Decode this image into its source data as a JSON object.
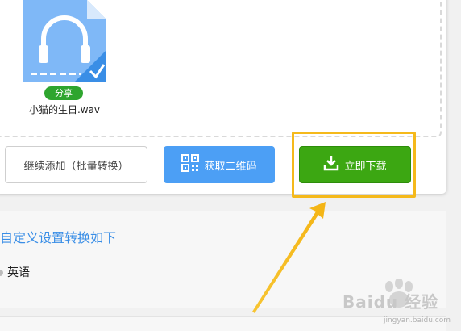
{
  "file": {
    "share_label": "分享",
    "name": "小猫的生日.wav",
    "icon": "headphones-file-icon",
    "check_icon": "checkmark-icon"
  },
  "actions": {
    "continue_label": "继续添加（批量转换）",
    "qr_label": "获取二维码",
    "qr_icon": "qr-code-icon",
    "download_label": "立即下载",
    "download_icon": "download-icon"
  },
  "settings": {
    "title": "自定义设置转换如下",
    "language": "英语"
  },
  "watermark": {
    "logo": "Baidu 经验",
    "site": "jingyan.baidu.com"
  },
  "colors": {
    "download_green": "#3ca712",
    "qr_blue": "#4c9ff5",
    "share_green": "#2ea52e",
    "highlight_yellow": "#f5b91b",
    "title_blue": "#3a8ee6",
    "file_icon_blue": "#7fb8f7"
  }
}
